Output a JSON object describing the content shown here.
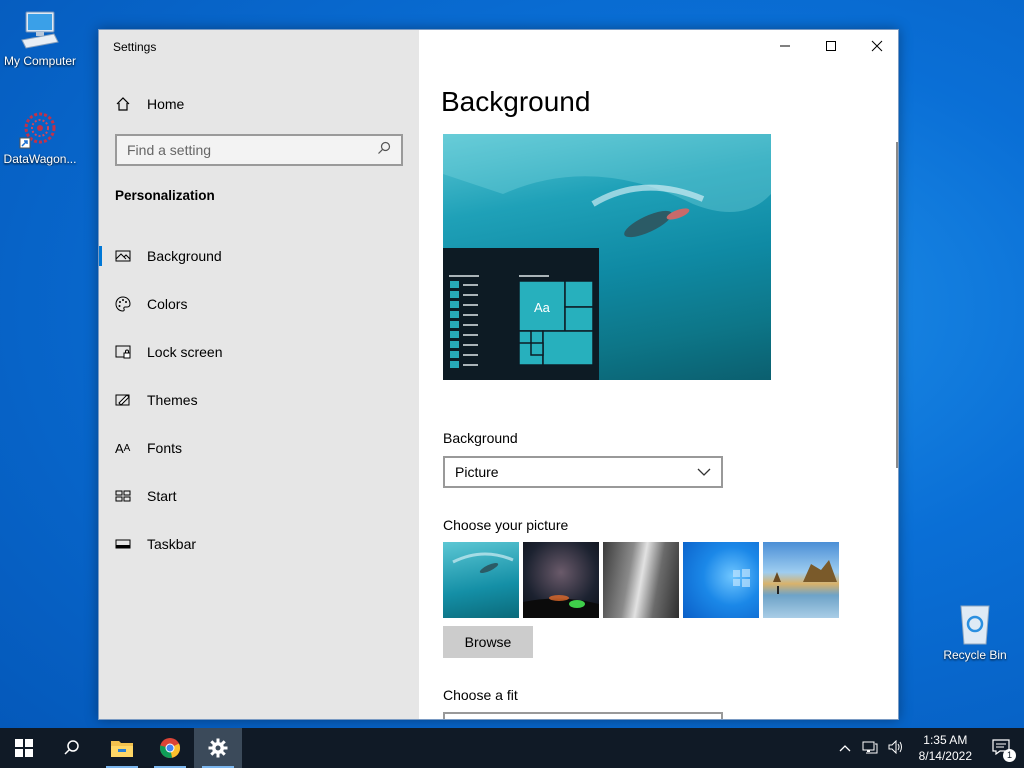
{
  "desktop": {
    "icons": [
      {
        "label": "My Computer"
      },
      {
        "label": "DataWagon..."
      },
      {
        "label": "Recycle Bin"
      }
    ]
  },
  "window": {
    "title": "Settings",
    "controls": {
      "minimize": "minimize",
      "maximize": "maximize",
      "close": "close"
    }
  },
  "sidebar": {
    "home_label": "Home",
    "search_placeholder": "Find a setting",
    "section_title": "Personalization",
    "items": [
      {
        "label": "Background",
        "icon": "picture-icon",
        "active": true
      },
      {
        "label": "Colors",
        "icon": "palette-icon"
      },
      {
        "label": "Lock screen",
        "icon": "lock-screen-icon"
      },
      {
        "label": "Themes",
        "icon": "themes-icon"
      },
      {
        "label": "Fonts",
        "icon": "fonts-icon"
      },
      {
        "label": "Start",
        "icon": "start-icon"
      },
      {
        "label": "Taskbar",
        "icon": "taskbar-icon"
      }
    ]
  },
  "main": {
    "page_title": "Background",
    "preview_tile_text": "Aa",
    "background_label": "Background",
    "background_value": "Picture",
    "choose_picture_label": "Choose your picture",
    "browse_label": "Browse",
    "choose_fit_label": "Choose a fit"
  },
  "taskbar": {
    "time": "1:35 AM",
    "date": "8/14/2022",
    "notification_count": "1"
  },
  "colors": {
    "accent": "#0078d7",
    "taskbar": "#101a26",
    "sidebar": "#e6e6e6"
  }
}
